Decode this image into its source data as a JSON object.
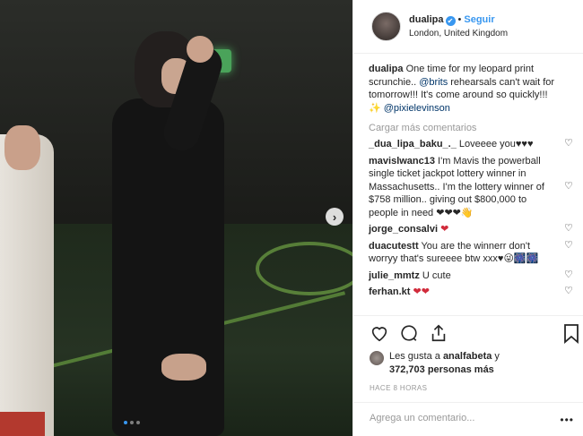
{
  "post": {
    "username": "dualipa",
    "follow_label": "Seguir",
    "location": "London, United Kingdom",
    "caption": {
      "user": "dualipa",
      "text_before": " One time for my leopard print scrunchie.. ",
      "mention1": "@brits",
      "text_after": " rehearsals can't wait for tomorrow!!! It's come around so quickly!!!",
      "emoji": "✨",
      "mention2": "@pixielevinson"
    },
    "load_more_label": "Cargar más comentarios",
    "comments": [
      {
        "user": "_dua_lipa_baku_._",
        "text": " Loveeee you♥♥♥"
      },
      {
        "user": "mavislwanc13",
        "text": " I'm Mavis the powerball single ticket jackpot lottery winner in Massachusetts.. I'm the lottery winner of $758 million.. giving out $800,000 to people in need ❤❤❤👋"
      },
      {
        "user": "jorge_consalvi",
        "text": " ❤"
      },
      {
        "user": "duacutestt",
        "text": " You are the winnerr don't worryy that's sureeee btw xxx♥😜🎆🎆"
      },
      {
        "user": "julie_mmtz",
        "text": " U cute"
      },
      {
        "user": "ferhan.kt",
        "text": " ❤❤"
      }
    ],
    "likes": {
      "prefix": "Les gusta a ",
      "user": "analfabeta",
      "middle": " y",
      "count": "372,703 personas más"
    },
    "time_ago": "HACE 8 HORAS",
    "add_comment_placeholder": "Agrega un comentario...",
    "more_options": "•••",
    "carousel": {
      "current": 1,
      "total": 3
    }
  },
  "colors": {
    "accent": "#3897f0",
    "mention": "#003569",
    "muted": "#999999"
  }
}
